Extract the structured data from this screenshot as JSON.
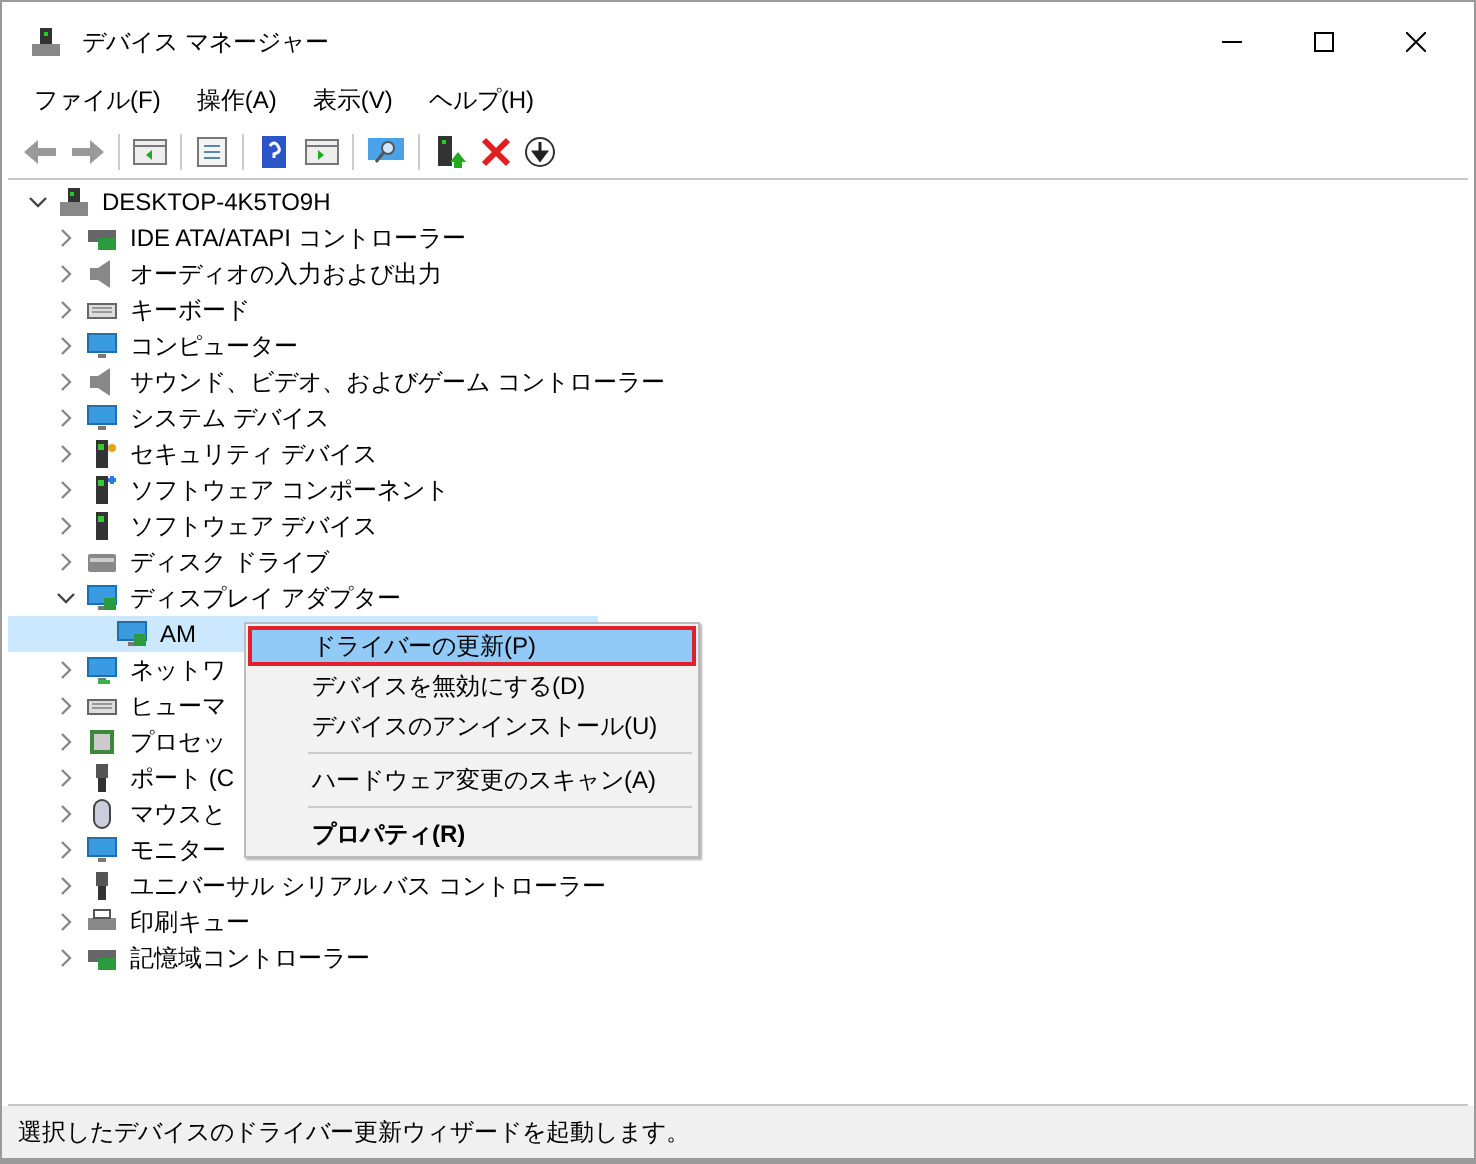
{
  "window": {
    "title": "デバイス マネージャー"
  },
  "menu_bar": [
    "ファイル(F)",
    "操作(A)",
    "表示(V)",
    "ヘルプ(H)"
  ],
  "tree": {
    "label": "DESKTOP-4K5TO9H",
    "expanded": true,
    "selected": false,
    "children": [
      {
        "label": "IDE ATA/ATAPI コントローラー",
        "expanded": false,
        "selected": false
      },
      {
        "label": "オーディオの入力および出力",
        "expanded": false,
        "selected": false
      },
      {
        "label": "キーボード",
        "expanded": false,
        "selected": false
      },
      {
        "label": "コンピューター",
        "expanded": false,
        "selected": false
      },
      {
        "label": "サウンド、ビデオ、およびゲーム コントローラー",
        "expanded": false,
        "selected": false
      },
      {
        "label": "システム デバイス",
        "expanded": false,
        "selected": false
      },
      {
        "label": "セキュリティ デバイス",
        "expanded": false,
        "selected": false
      },
      {
        "label": "ソフトウェア コンポーネント",
        "expanded": false,
        "selected": false
      },
      {
        "label": "ソフトウェア デバイス",
        "expanded": false,
        "selected": false
      },
      {
        "label": "ディスク ドライブ",
        "expanded": false,
        "selected": false
      },
      {
        "label": "ディスプレイ アダプター",
        "expanded": true,
        "selected": false,
        "children": [
          {
            "label": "AM",
            "selected": true
          }
        ]
      },
      {
        "label": "ネットワ",
        "expanded": false,
        "selected": false
      },
      {
        "label": "ヒューマ",
        "expanded": false,
        "selected": false
      },
      {
        "label": "プロセッ",
        "expanded": false,
        "selected": false
      },
      {
        "label": "ポート (C",
        "expanded": false,
        "selected": false
      },
      {
        "label": "マウスと",
        "expanded": false,
        "selected": false
      },
      {
        "label": "モニター",
        "expanded": false,
        "selected": false
      },
      {
        "label": "ユニバーサル シリアル バス コントローラー",
        "expanded": false,
        "selected": false
      },
      {
        "label": "印刷キュー",
        "expanded": false,
        "selected": false
      },
      {
        "label": "記憶域コントローラー",
        "expanded": false,
        "selected": false
      }
    ]
  },
  "context_menu": [
    {
      "kind": "item",
      "label": "ドライバーの更新(P)",
      "selected": true,
      "bold": false
    },
    {
      "kind": "item",
      "label": "デバイスを無効にする(D)",
      "selected": false,
      "bold": false
    },
    {
      "kind": "item",
      "label": "デバイスのアンインストール(U)",
      "selected": false,
      "bold": false
    },
    {
      "kind": "separator"
    },
    {
      "kind": "item",
      "label": "ハードウェア変更のスキャン(A)",
      "selected": false,
      "bold": false
    },
    {
      "kind": "separator"
    },
    {
      "kind": "item",
      "label": "プロパティ(R)",
      "selected": false,
      "bold": true
    }
  ],
  "status_bar": "選択したデバイスのドライバー更新ウィザードを起動します。"
}
